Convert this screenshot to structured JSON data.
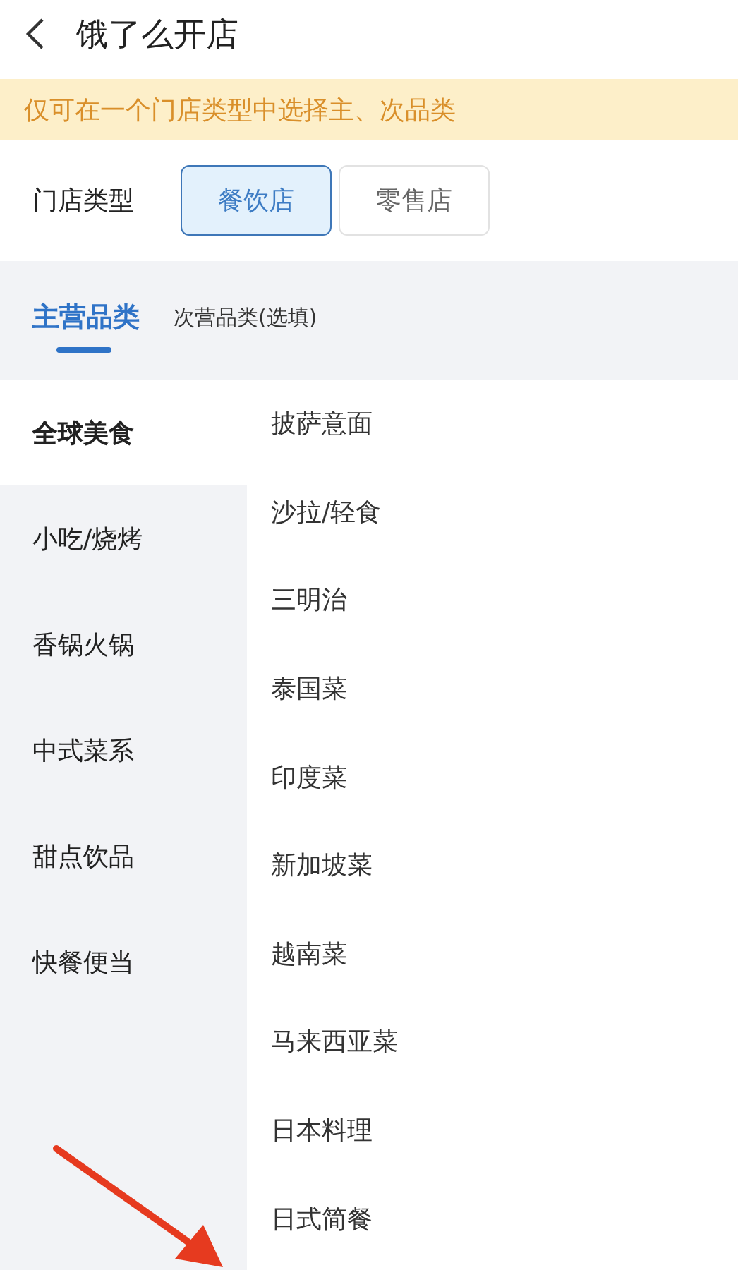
{
  "header": {
    "title": "饿了么开店"
  },
  "notice": "仅可在一个门店类型中选择主、次品类",
  "store_type": {
    "label": "门店类型",
    "options": [
      {
        "label": "餐饮店",
        "selected": true
      },
      {
        "label": "零售店",
        "selected": false
      }
    ]
  },
  "tabs": [
    {
      "label": "主营品类",
      "selected": true
    },
    {
      "label": "次营品类(选填)",
      "selected": false
    }
  ],
  "categories": [
    {
      "label": "全球美食",
      "selected": true
    },
    {
      "label": "小吃/烧烤",
      "selected": false
    },
    {
      "label": "香锅火锅",
      "selected": false
    },
    {
      "label": "中式菜系",
      "selected": false
    },
    {
      "label": "甜点饮品",
      "selected": false
    },
    {
      "label": "快餐便当",
      "selected": false
    }
  ],
  "subcategories": [
    "披萨意面",
    "沙拉/轻食",
    "三明治",
    "泰国菜",
    "印度菜",
    "新加坡菜",
    "越南菜",
    "马来西亚菜",
    "日本料理",
    "日式简餐"
  ]
}
